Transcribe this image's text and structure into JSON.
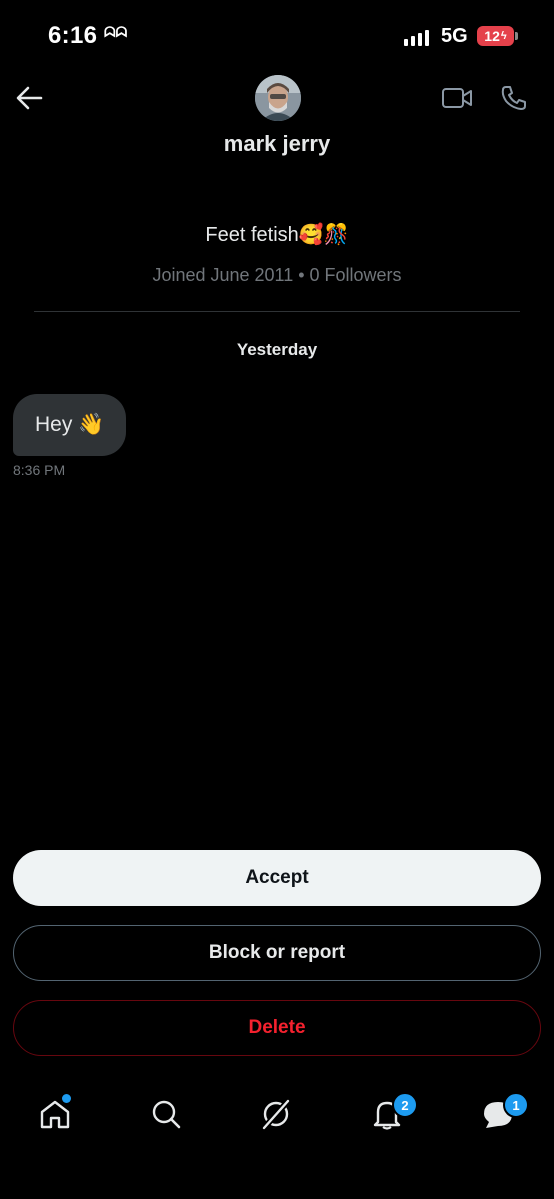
{
  "status_bar": {
    "time": "6:16",
    "glyph": "ᗣᗣ",
    "network": "5G",
    "battery": "12"
  },
  "header": {
    "contact_name": "mark jerry"
  },
  "profile": {
    "bio": "Feet fetish🥰🎊",
    "joined": "Joined June 2011 • 0 Followers"
  },
  "conversation": {
    "day_label": "Yesterday",
    "messages": [
      {
        "text": "Hey 👋",
        "time": "8:36 PM"
      }
    ]
  },
  "actions": {
    "accept_label": "Accept",
    "block_label": "Block or report",
    "delete_label": "Delete"
  },
  "bottom_nav": {
    "notifications_badge": "2",
    "messages_badge": "1"
  },
  "colors": {
    "background": "#000000",
    "accent": "#1d9bf0",
    "danger": "#f4212e",
    "battery": "#e5414b"
  },
  "icons": [
    "back-arrow-icon",
    "video-call-icon",
    "phone-call-icon",
    "home-icon",
    "search-icon",
    "grok-icon",
    "bell-icon",
    "messages-icon"
  ]
}
